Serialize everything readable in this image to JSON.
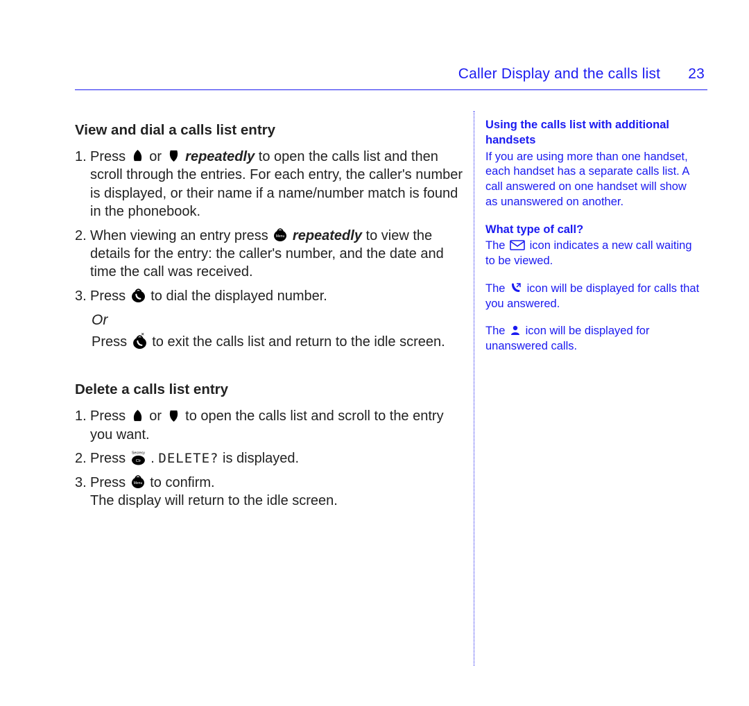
{
  "header": {
    "title": "Caller Display and the calls list",
    "page_number": "23"
  },
  "main": {
    "section1": {
      "heading": "View and dial a calls list entry",
      "item1_prefix": "Press ",
      "item1_mid": " or ",
      "item1_emph": "repeatedly",
      "item1_rest": " to open the calls list and then scroll through the entries. For each entry, the caller's number is displayed, or their name if a name/number match is found in the phonebook.",
      "item2_prefix": "When viewing an entry press ",
      "item2_emph": "repeatedly",
      "item2_rest": " to view the details for the entry: the caller's number, and the date and time the call was received.",
      "item3_prefix": "Press ",
      "item3_rest": " to dial the displayed number.",
      "or": "Or",
      "alt_prefix": "Press ",
      "alt_rest": " to exit the calls list and return to the idle screen."
    },
    "section2": {
      "heading": "Delete a calls list entry",
      "item1_prefix": "Press ",
      "item1_mid": " or ",
      "item1_rest": " to open the calls list and scroll to the entry you want.",
      "item2_prefix": "Press ",
      "item2_mid": ". ",
      "item2_code": "DELETE?",
      "item2_rest": " is displayed.",
      "item3_prefix": "Press ",
      "item3_rest": " to confirm.",
      "item3_line2": "The display will return to the idle screen."
    }
  },
  "side": {
    "h1": "Using the calls list with additional handsets",
    "p1": "If you are using more than one handset, each handset has a separate calls list. A call answered on one handset will show as unanswered on another.",
    "h2": "What type of call?",
    "p2a": "The ",
    "p2b": " icon indicates a new call waiting to be viewed.",
    "p3a": "The ",
    "p3b": " icon will be displayed for calls that you answered.",
    "p4a": "The ",
    "p4b": " icon will be displayed for unanswered calls."
  }
}
